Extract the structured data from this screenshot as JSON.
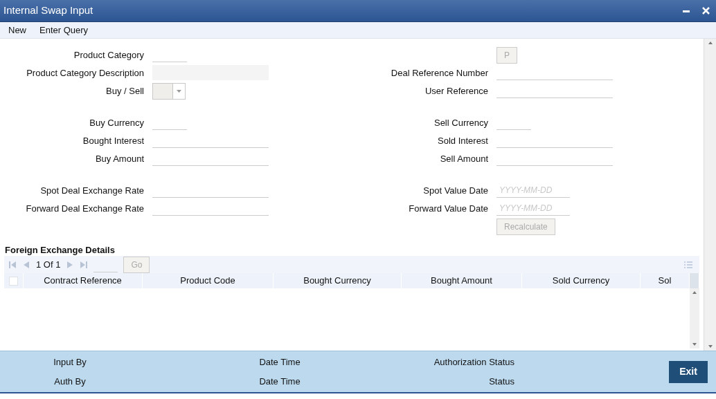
{
  "window": {
    "title": "Internal Swap Input"
  },
  "menu": [
    {
      "label": "New"
    },
    {
      "label": "Enter Query"
    }
  ],
  "form": {
    "sections": [
      [
        {
          "left": {
            "kind": "code",
            "label": "Product Category"
          },
          "right": {
            "kind": "button",
            "label": "P",
            "disabled": true
          }
        },
        {
          "left": {
            "kind": "readonly",
            "label": "Product Category Description"
          },
          "right": {
            "kind": "text",
            "label": "Deal Reference Number"
          }
        },
        {
          "left": {
            "kind": "select",
            "label": "Buy / Sell"
          },
          "right": {
            "kind": "text",
            "label": "User Reference"
          }
        }
      ],
      [
        {
          "left": {
            "kind": "code",
            "label": "Buy Currency"
          },
          "right": {
            "kind": "code",
            "label": "Sell Currency"
          }
        },
        {
          "left": {
            "kind": "text",
            "label": "Bought Interest"
          },
          "right": {
            "kind": "text",
            "label": "Sold Interest"
          }
        },
        {
          "left": {
            "kind": "text",
            "label": "Buy Amount"
          },
          "right": {
            "kind": "text",
            "label": "Sell Amount"
          }
        }
      ],
      [
        {
          "left": {
            "kind": "text",
            "label": "Spot Deal Exchange Rate"
          },
          "right": {
            "kind": "date",
            "label": "Spot Value Date",
            "placeholder": "YYYY-MM-DD"
          }
        },
        {
          "left": {
            "kind": "text",
            "label": "Forward Deal Exchange Rate"
          },
          "right": {
            "kind": "date",
            "label": "Forward Value Date",
            "placeholder": "YYYY-MM-DD"
          }
        },
        {
          "right": {
            "kind": "button",
            "label": "Recalculate",
            "disabled": true
          }
        }
      ]
    ]
  },
  "grid": {
    "title": "Foreign Exchange Details",
    "page": "1 Of 1",
    "go": "Go",
    "select_all": {
      "checked": false
    },
    "columns": [
      "Contract Reference",
      "Product Code",
      "Bought Currency",
      "Bought Amount",
      "Sold Currency",
      "Sol"
    ]
  },
  "footer": {
    "rows": [
      [
        "Input By",
        "Date Time",
        "Authorization Status"
      ],
      [
        "Auth By",
        "Date Time",
        "Status"
      ]
    ],
    "exit": "Exit"
  }
}
